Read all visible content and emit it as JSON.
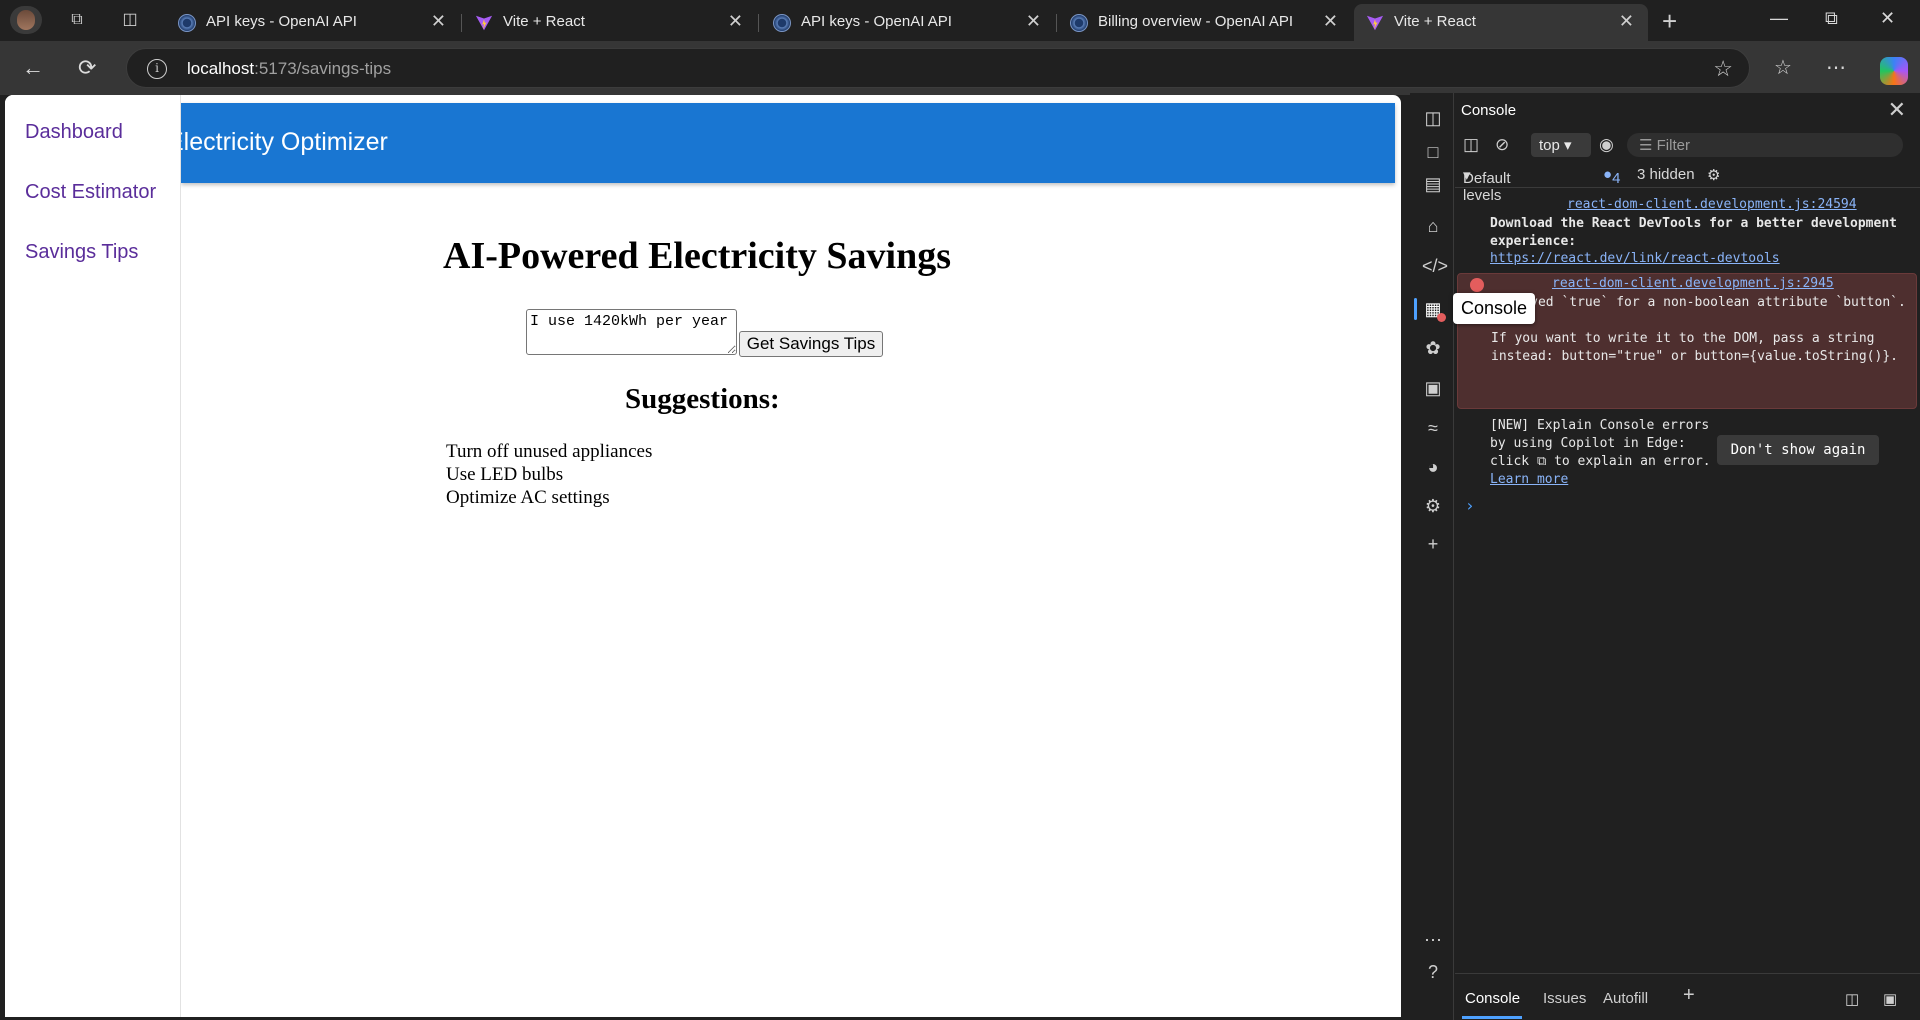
{
  "browser": {
    "tabs": [
      {
        "title": "API keys - OpenAI API",
        "favicon": "openai-icon"
      },
      {
        "title": "Vite + React",
        "favicon": "vite-icon"
      },
      {
        "title": "API keys - OpenAI API",
        "favicon": "openai-icon"
      },
      {
        "title": "Billing overview - OpenAI API",
        "favicon": "openai-icon"
      },
      {
        "title": "Vite + React",
        "favicon": "vite-icon",
        "active": true
      }
    ],
    "address": {
      "host": "localhost",
      "path": ":5173/savings-tips"
    }
  },
  "app": {
    "header_title": "Electricity Optimizer",
    "nav": [
      "Dashboard",
      "Cost Estimator",
      "Savings Tips"
    ],
    "page_title": "AI-Powered Electricity Savings",
    "input_value": "I use 1420kWh per year",
    "button_label": "Get Savings Tips",
    "suggestions_heading": "Suggestions:",
    "suggestions": [
      "Turn off unused appliances",
      "Use LED bulbs",
      "Optimize AC settings"
    ],
    "accent_color": "#1976d2"
  },
  "devtools": {
    "panel_title": "Console",
    "tooltip": "Console",
    "context": "top",
    "filter_placeholder": "Filter",
    "levels": "Default levels",
    "message_count": "4",
    "hidden": "3 hidden",
    "messages": {
      "info_source": "react-dom-client.development.js:24594",
      "info_text": "Download the React DevTools for a better development experience:",
      "info_link": "https://react.dev/link/react-devtools",
      "error_source": "react-dom-client.development.js:2945",
      "error_text": "Received `true` for a non-boolean attribute `button`.\n\nIf you want to write it to the DOM, pass a string instead: button=\"true\" or button={value.toString()}.",
      "tip_text": "[NEW] Explain Console errors by using Copilot in Edge: click",
      "tip_text2": "to explain an error.",
      "tip_link": "Learn more",
      "dont_show": "Don't show again"
    },
    "bottom_tabs": [
      "Console",
      "Issues",
      "Autofill"
    ]
  }
}
